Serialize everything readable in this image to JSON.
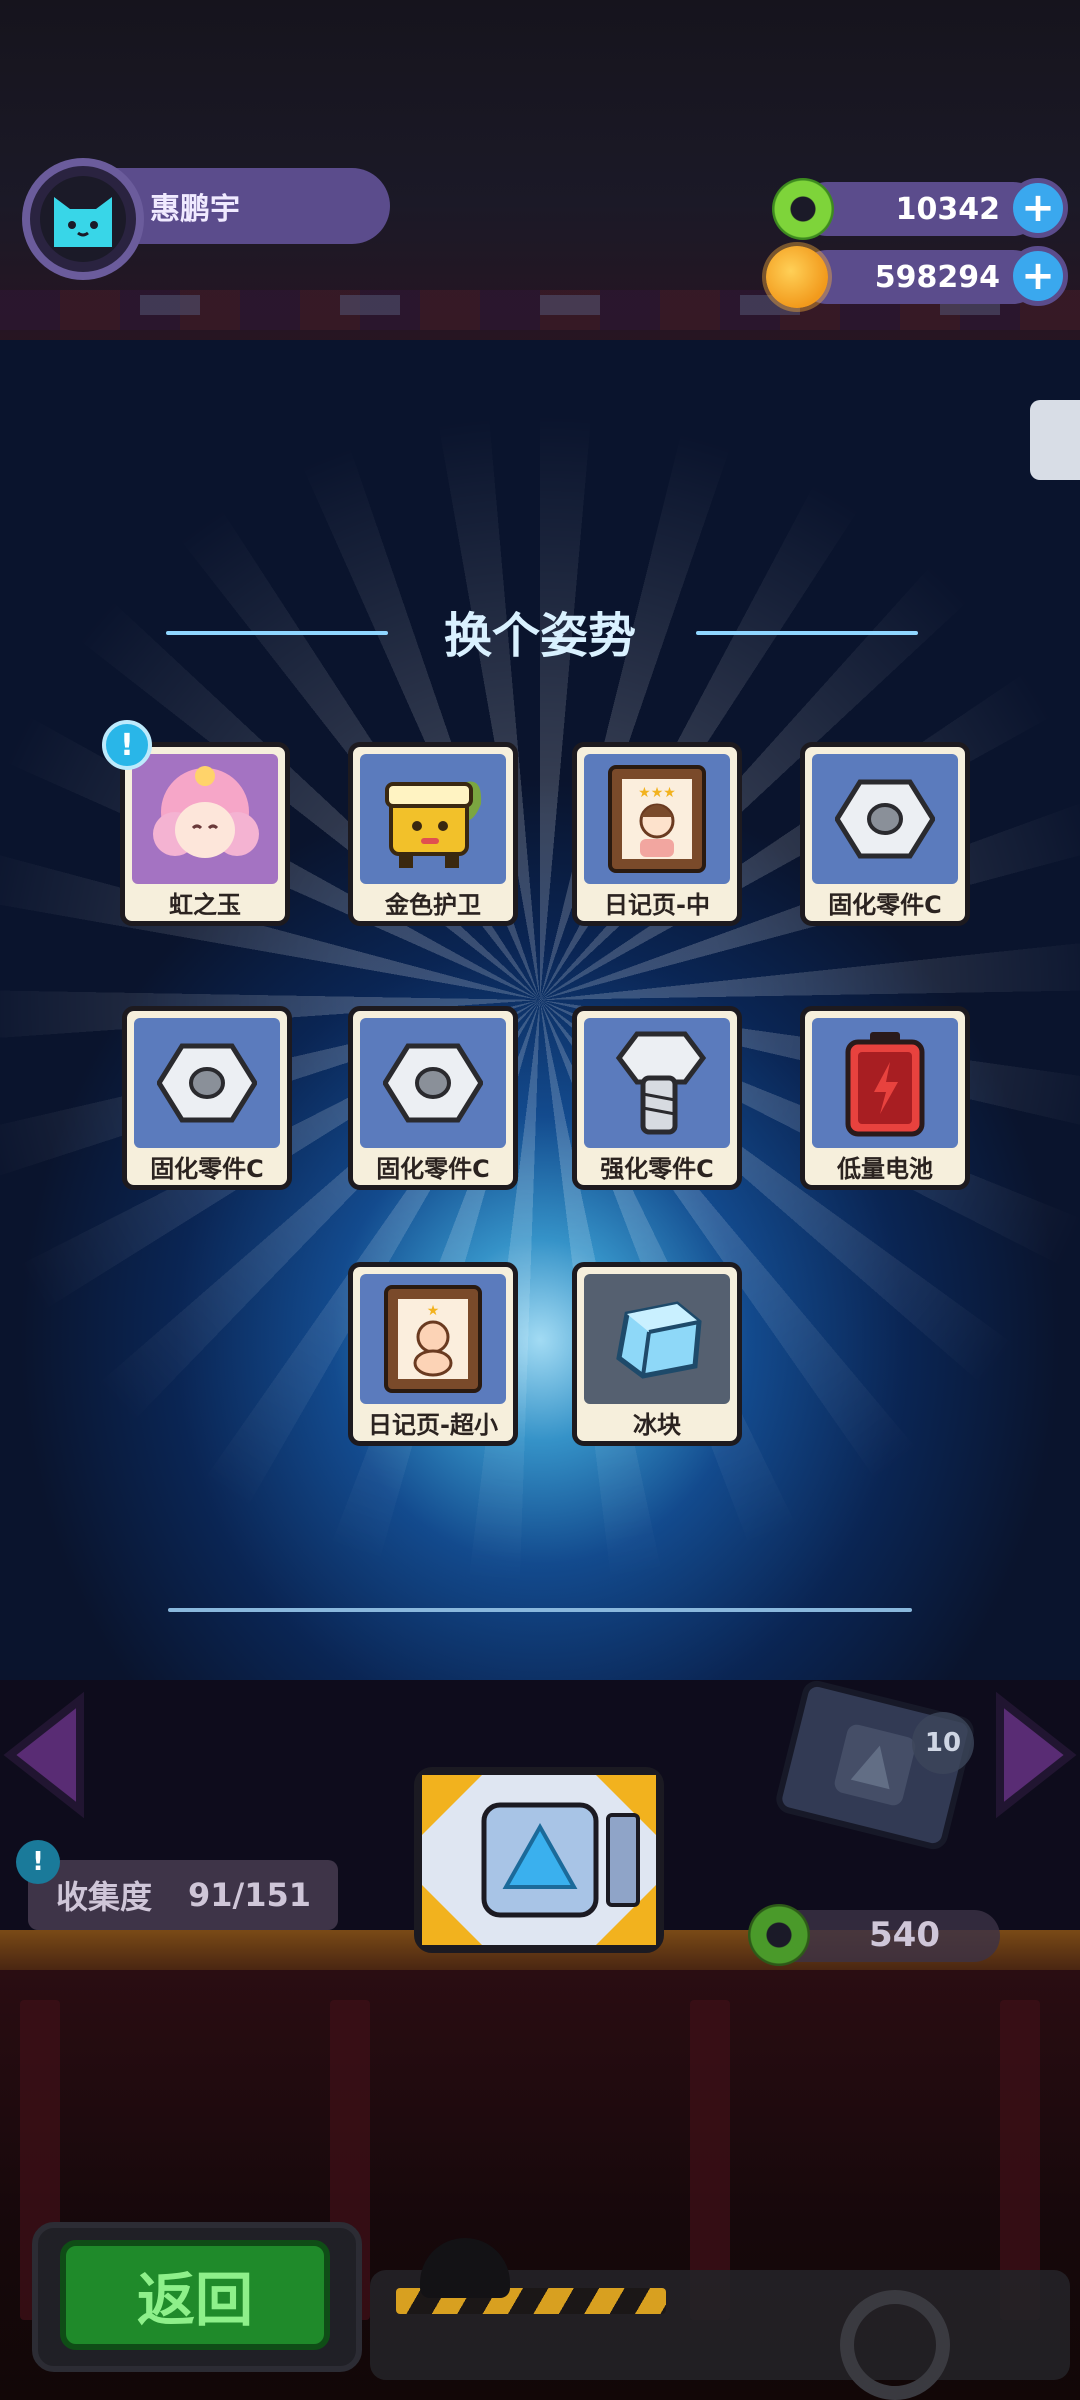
{
  "header": {
    "player_name": "惠鹏宇",
    "currencies": [
      {
        "icon": "green-donut-coin-icon",
        "value": "10342"
      },
      {
        "icon": "orange-planet-coin-icon",
        "value": "598294"
      }
    ]
  },
  "title": "换个姿势",
  "rewards": [
    {
      "label": "虹之玉",
      "icon": "pink-hair-character-icon",
      "bg": "#a473c2",
      "has_badge": true,
      "badge": "!"
    },
    {
      "label": "金色护卫",
      "icon": "golden-guard-character-icon",
      "bg": "#5b7bbd"
    },
    {
      "label": "日记页-中",
      "icon": "diary-page-portrait-icon",
      "bg": "#5b7bbd"
    },
    {
      "label": "固化零件C",
      "icon": "hex-nut-icon",
      "bg": "#5b7bbd"
    },
    {
      "label": "固化零件C",
      "icon": "hex-nut-icon",
      "bg": "#5b7bbd"
    },
    {
      "label": "固化零件C",
      "icon": "hex-nut-icon",
      "bg": "#5b7bbd"
    },
    {
      "label": "强化零件C",
      "icon": "bolt-icon",
      "bg": "#5b7bbd"
    },
    {
      "label": "低量电池",
      "icon": "low-battery-icon",
      "bg": "#5b7bbd"
    },
    {
      "label": "日记页-超小",
      "icon": "diary-page-baby-icon",
      "bg": "#5b7bbd"
    },
    {
      "label": "冰块",
      "icon": "ice-cube-icon",
      "bg": "#556070"
    }
  ],
  "collection": {
    "label": "收集度",
    "value": "91/151",
    "badge": "!"
  },
  "chest": {
    "count_badge": "10",
    "cost": "540"
  },
  "back_button": "返回",
  "colors": {
    "accent_blue": "#3aa8ee",
    "pill_purple": "#5b4c8c",
    "back_green": "#1f8a2a"
  }
}
